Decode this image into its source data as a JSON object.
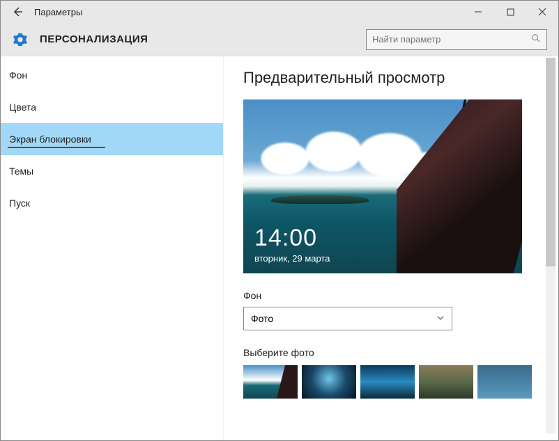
{
  "window": {
    "title": "Параметры"
  },
  "header": {
    "category": "ПЕРСОНАЛИЗАЦИЯ",
    "search_placeholder": "Найти параметр"
  },
  "sidebar": {
    "items": [
      {
        "label": "Фон",
        "selected": false
      },
      {
        "label": "Цвета",
        "selected": false
      },
      {
        "label": "Экран блокировки",
        "selected": true
      },
      {
        "label": "Темы",
        "selected": false
      },
      {
        "label": "Пуск",
        "selected": false
      }
    ]
  },
  "content": {
    "preview_heading": "Предварительный просмотр",
    "lock_time": "14:00",
    "lock_date": "вторник, 29 марта",
    "background_label": "Фон",
    "background_value": "Фото",
    "choose_photo_label": "Выберите фото"
  }
}
